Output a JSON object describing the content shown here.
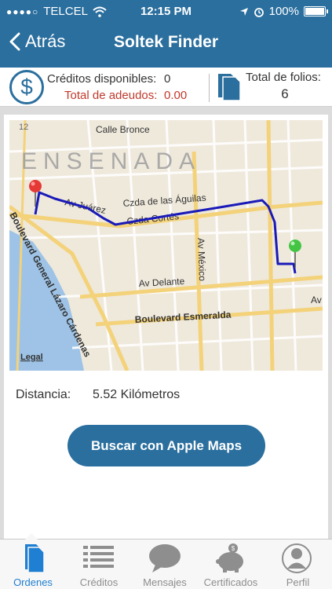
{
  "status_bar": {
    "carrier": "TELCEL",
    "time": "12:15 PM",
    "battery": "100%"
  },
  "nav": {
    "back_label": "Atrás",
    "title": "Soltek Finder"
  },
  "info": {
    "credits_label": "Créditos disponibles:",
    "credits_value": "0",
    "debt_label": "Total de adeudos:",
    "debt_value": "0.00",
    "folios_label": "Total de folios:",
    "folios_value": "6"
  },
  "map": {
    "city_label": "ENSENADA",
    "streets": [
      "Calle Bronce",
      "Czda de las Águilas",
      "Av Juárez",
      "Czda Cortés",
      "Av México",
      "Av Delante",
      "Boulevard Esmeralda",
      "Boulevard General Lázaro Cárdenas",
      "Av"
    ],
    "corner_number": "12",
    "legal": "Legal",
    "route_color": "#1a1ab8",
    "start_pin_color": "#e53935",
    "end_pin_color": "#43c443"
  },
  "distance": {
    "label": "Distancia:",
    "value": "5.52 Kilómetros"
  },
  "action": {
    "apple_maps_label": "Buscar con Apple Maps"
  },
  "tabs": [
    {
      "label": "Ordenes",
      "icon": "document-icon",
      "active": true
    },
    {
      "label": "Créditos",
      "icon": "list-icon",
      "active": false
    },
    {
      "label": "Mensajes",
      "icon": "chat-bubble-icon",
      "active": false
    },
    {
      "label": "Certificados",
      "icon": "piggy-bank-icon",
      "active": false
    },
    {
      "label": "Perfil",
      "icon": "user-icon",
      "active": false
    }
  ],
  "colors": {
    "brand": "#2b6f9e",
    "active_tab": "#1f7fd2",
    "debt": "#c0392b"
  }
}
